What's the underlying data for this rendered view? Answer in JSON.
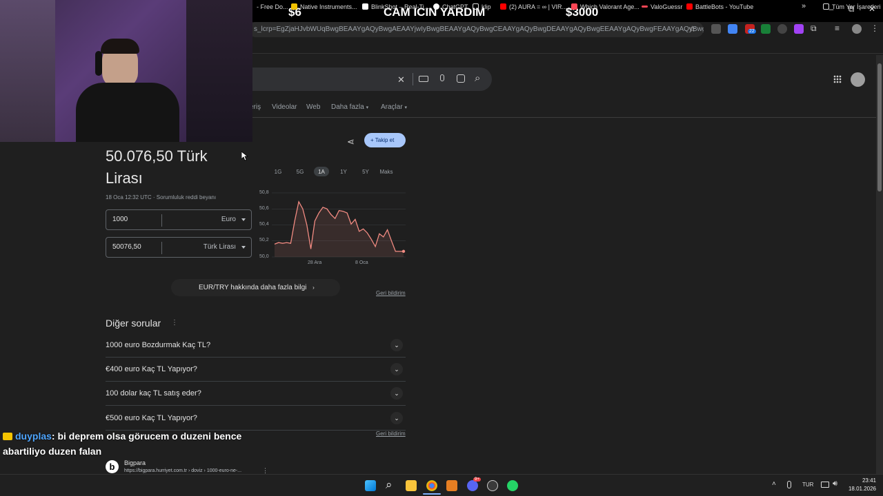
{
  "stream_banner": {
    "left": "$6",
    "center": "CAM ICIN YARDIM",
    "right": "$3000"
  },
  "window_controls": {
    "minimize": "–",
    "restore": "⧉",
    "close": "✕"
  },
  "browser": {
    "url": "s_lcrp=EgZjaHJvbWUqBwgBEAAYgAQyBwgAEAAYjwIyBwgBEAAYgAQyBwgCEAAYgAQyBwgDEAAYgAQyBwgEEAAYgAQyBwgFEAAYgAQyBwgGEAAYgAQ...",
    "ext_badge": "22",
    "bookmarks": [
      {
        "label": "- Free Do...",
        "color": "#ffffff"
      },
      {
        "label": "Native Instruments...",
        "color": "#f2c200"
      },
      {
        "label": "BlinkShot – Real-Ti...",
        "color": "#ffffff"
      },
      {
        "label": "ChatGPT",
        "color": "#ffffff"
      },
      {
        "label": "klip",
        "color": "#ffffff"
      },
      {
        "label": "(2) AURA = ∞ | VIR...",
        "color": "#ff0000"
      },
      {
        "label": "Which Valorant Age...",
        "color": "#ff4655"
      },
      {
        "label": "ValoGuessr",
        "color": "#ff4655"
      },
      {
        "label": "BattleBots - YouTube",
        "color": "#ff0000"
      }
    ],
    "bookmarks_more": "»",
    "all_bookmarks": "Tüm Yer İşaretleri"
  },
  "search": {
    "tabs": [
      "eriş",
      "Videolar",
      "Web",
      "Daha fazla",
      "Araçlar"
    ],
    "clear_icon": "✕",
    "search_icon": "⌕"
  },
  "result": {
    "amount_line1": "50.076,50 Türk",
    "amount_line2": "Lirası",
    "timestamp": "18 Oca 12:32 UTC · Sorumluluk reddi beyanı",
    "follow_button": "Takip et",
    "converter": [
      {
        "value": "1000",
        "currency": "Euro"
      },
      {
        "value": "50076,50",
        "currency": "Türk Lirası"
      }
    ],
    "ranges": [
      "1G",
      "5G",
      "1A",
      "1Y",
      "5Y",
      "Maks"
    ],
    "active_range": "1A",
    "more_info": "EUR/TRY hakkında daha fazla bilgi",
    "feedback": "Geri bildirim"
  },
  "chart_data": {
    "type": "line",
    "title": "",
    "xlabel": "",
    "ylabel": "",
    "y_ticks": [
      "50,8",
      "50,6",
      "50,4",
      "50,2",
      "50,0"
    ],
    "x_ticks": [
      "28 Ara",
      "8 Oca"
    ],
    "ylim": [
      50.0,
      50.8
    ],
    "color": "#f28b82",
    "values": [
      50.16,
      50.18,
      50.17,
      50.18,
      50.17,
      50.45,
      50.69,
      50.6,
      50.4,
      50.1,
      50.45,
      50.55,
      50.62,
      50.6,
      50.53,
      50.48,
      50.58,
      50.57,
      50.55,
      50.41,
      50.47,
      50.32,
      50.35,
      50.3,
      50.22,
      50.13,
      50.29,
      50.25,
      50.34,
      50.2,
      50.07,
      50.07,
      50.07
    ]
  },
  "other_questions": {
    "heading": "Diğer sorular",
    "items": [
      "1000 euro Bozdurmak Kaç TL?",
      "€400 euro Kaç TL Yapıyor?",
      "100 dolar kaç TL satış eder?",
      "€500 euro Kaç TL Yapıyor?"
    ],
    "feedback": "Geri bildirim"
  },
  "source": {
    "name": "Bigpara",
    "url": "https://bigpara.hurriyet.com.tr › doviz › 1000-euro-ne-..."
  },
  "chat": {
    "user": "duyplas",
    "message": ": bi deprem olsa görucem o duzeni bence abartiliyo duzen falan"
  },
  "taskbar": {
    "lang": "TUR",
    "time": "23:41",
    "date": "18.01.2026",
    "discord_badge": "9+"
  }
}
